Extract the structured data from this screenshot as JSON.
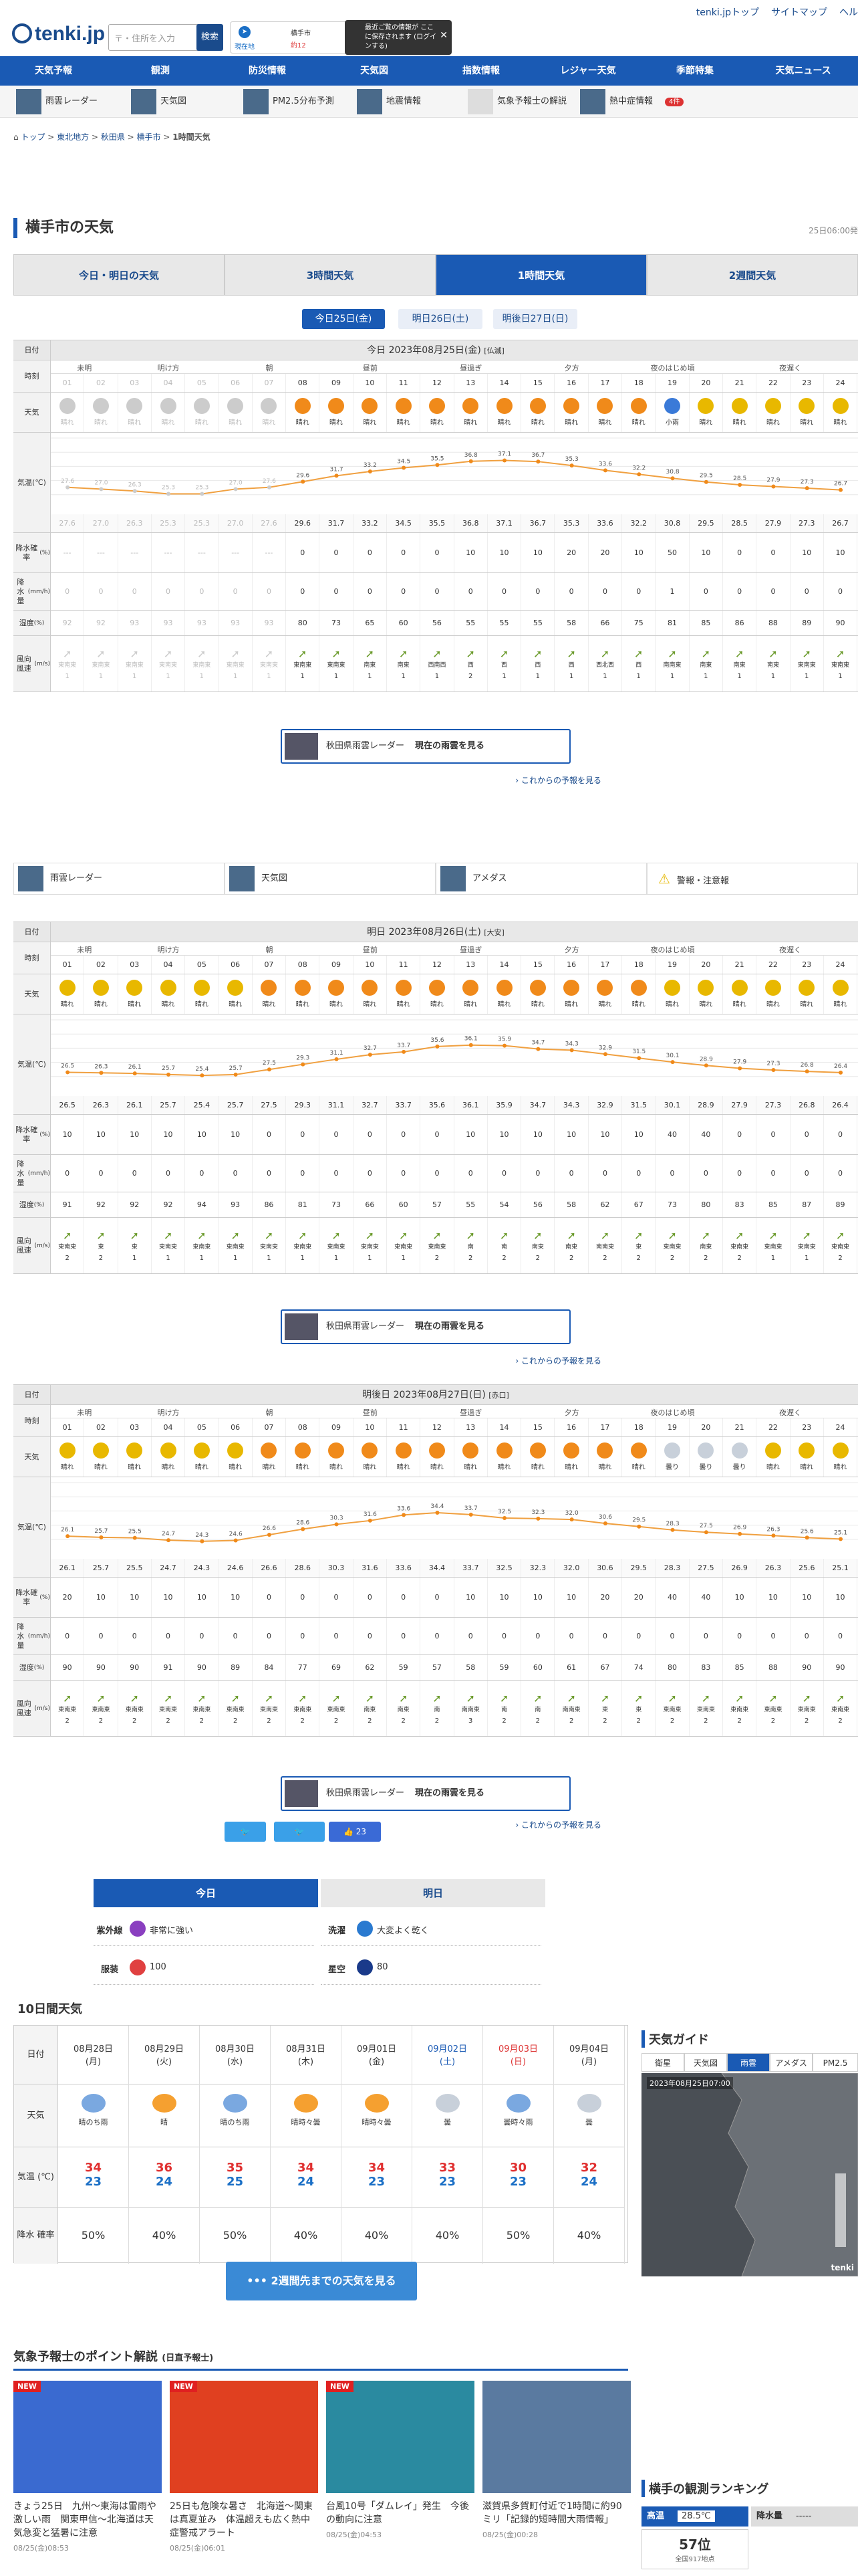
{
  "header": {
    "logo": "tenki.jp",
    "search_placeholder": "〒・住所を入力",
    "search_btn": "検索",
    "curloc_title": "現在地",
    "curloc_city": "横手市",
    "curloc_now": "約12",
    "tip": "最近ご覧の情報が ここに保存されます (ログインする)",
    "links": [
      "tenki.jpトップ",
      "サイトマップ",
      "ヘル"
    ]
  },
  "nav": [
    "天気予報",
    "観測",
    "防災情報",
    "天気図",
    "指数情報",
    "レジャー天気",
    "季節特集",
    "天気ニュース"
  ],
  "subnav": [
    "雨雲レーダー",
    "天気図",
    "PM2.5分布予測",
    "地震情報",
    "気象予報士の解説",
    "熱中症情報"
  ],
  "badge": "4件",
  "breadcrumb": [
    "トップ",
    "東北地方",
    "秋田県",
    "横手市",
    "1時間天気"
  ],
  "page_title": "横手市の天気",
  "page_date": "25日06:00発",
  "tabs": [
    "今日・明日の天気",
    "3時間天気",
    "1時間天気",
    "2週間天気"
  ],
  "date_tabs": [
    "今日25日(金)",
    "明日26日(土)",
    "明後日27日(日)"
  ],
  "labels": {
    "date": "日付",
    "time": "時刻",
    "weather": "天気",
    "temp": "気温",
    "temp_u": "(℃)",
    "temp_top": "高温",
    "prec": "降水確率",
    "prec_u": "(%)",
    "rain": "降水量",
    "rain_u": "(mm/h)",
    "hum": "湿度",
    "hum_u": "(%)",
    "wind": "風向 風速",
    "wind_u": "(m/s)"
  },
  "periods": [
    "未明",
    "明け方",
    "朝",
    "昼前",
    "昼過ぎ",
    "夕方",
    "夜のはじめ頃",
    "夜遅く"
  ],
  "hours": [
    "01",
    "02",
    "03",
    "04",
    "05",
    "06",
    "07",
    "08",
    "09",
    "10",
    "11",
    "12",
    "13",
    "14",
    "15",
    "16",
    "17",
    "18",
    "19",
    "20",
    "21",
    "22",
    "23",
    "24"
  ],
  "days": [
    {
      "head": "今日 2023年08月25日(金)",
      "rok": "[仏滅]",
      "past": 7,
      "weather": [
        "晴れ",
        "晴れ",
        "晴れ",
        "晴れ",
        "晴れ",
        "晴れ",
        "晴れ",
        "晴れ",
        "晴れ",
        "晴れ",
        "晴れ",
        "晴れ",
        "晴れ",
        "晴れ",
        "晴れ",
        "晴れ",
        "晴れ",
        "晴れ",
        "小雨",
        "晴れ",
        "晴れ",
        "晴れ",
        "晴れ",
        "晴れ"
      ],
      "temp": [
        "27.6",
        "27.0",
        "26.3",
        "25.3",
        "25.3",
        "27.0",
        "27.6",
        "29.6",
        "31.7",
        "33.2",
        "34.5",
        "35.5",
        "36.8",
        "37.1",
        "36.7",
        "35.3",
        "33.6",
        "32.2",
        "30.8",
        "29.5",
        "28.5",
        "27.9",
        "27.3",
        "26.7"
      ],
      "prec": [
        "---",
        "---",
        "---",
        "---",
        "---",
        "---",
        "---",
        "0",
        "0",
        "0",
        "0",
        "0",
        "10",
        "10",
        "10",
        "20",
        "20",
        "10",
        "50",
        "10",
        "0",
        "0",
        "10",
        "10"
      ],
      "rain": [
        "0",
        "0",
        "0",
        "0",
        "0",
        "0",
        "0",
        "0",
        "0",
        "0",
        "0",
        "0",
        "0",
        "0",
        "0",
        "0",
        "0",
        "0",
        "1",
        "0",
        "0",
        "0",
        "0",
        "0"
      ],
      "hum": [
        "92",
        "92",
        "93",
        "93",
        "93",
        "93",
        "93",
        "80",
        "73",
        "65",
        "60",
        "56",
        "55",
        "55",
        "55",
        "58",
        "66",
        "75",
        "81",
        "85",
        "86",
        "88",
        "89",
        "90"
      ],
      "wdir": [
        "東南東",
        "東南東",
        "東南東",
        "東南東",
        "東南東",
        "東南東",
        "東南東",
        "東南東",
        "東南東",
        "南東",
        "南東",
        "西南西",
        "西",
        "西",
        "西",
        "西",
        "西北西",
        "西",
        "南南東",
        "南東",
        "南東",
        "南東",
        "東南東",
        "東南東"
      ],
      "wsp": [
        "1",
        "1",
        "1",
        "1",
        "1",
        "1",
        "1",
        "1",
        "1",
        "1",
        "1",
        "1",
        "2",
        "1",
        "1",
        "1",
        "1",
        "1",
        "1",
        "1",
        "1",
        "1",
        "1",
        "1"
      ]
    },
    {
      "head": "明日 2023年08月26日(土)",
      "rok": "[大安]",
      "past": 0,
      "weather": [
        "晴れ",
        "晴れ",
        "晴れ",
        "晴れ",
        "晴れ",
        "晴れ",
        "晴れ",
        "晴れ",
        "晴れ",
        "晴れ",
        "晴れ",
        "晴れ",
        "晴れ",
        "晴れ",
        "晴れ",
        "晴れ",
        "晴れ",
        "晴れ",
        "晴れ",
        "晴れ",
        "晴れ",
        "晴れ",
        "晴れ",
        "晴れ"
      ],
      "temp": [
        "26.5",
        "26.3",
        "26.1",
        "25.7",
        "25.4",
        "25.7",
        "27.5",
        "29.3",
        "31.1",
        "32.7",
        "33.7",
        "35.6",
        "36.1",
        "35.9",
        "34.7",
        "34.3",
        "32.9",
        "31.5",
        "30.1",
        "28.9",
        "27.9",
        "27.3",
        "26.8",
        "26.4"
      ],
      "prec": [
        "10",
        "10",
        "10",
        "10",
        "10",
        "10",
        "0",
        "0",
        "0",
        "0",
        "0",
        "0",
        "10",
        "10",
        "10",
        "10",
        "10",
        "10",
        "40",
        "40",
        "0",
        "0",
        "0",
        "0"
      ],
      "rain": [
        "0",
        "0",
        "0",
        "0",
        "0",
        "0",
        "0",
        "0",
        "0",
        "0",
        "0",
        "0",
        "0",
        "0",
        "0",
        "0",
        "0",
        "0",
        "0",
        "0",
        "0",
        "0",
        "0",
        "0"
      ],
      "hum": [
        "91",
        "92",
        "92",
        "92",
        "94",
        "93",
        "86",
        "81",
        "73",
        "66",
        "60",
        "57",
        "55",
        "54",
        "56",
        "58",
        "62",
        "67",
        "73",
        "80",
        "83",
        "85",
        "87",
        "89"
      ],
      "wdir": [
        "東南東",
        "東",
        "東",
        "東南東",
        "東南東",
        "東南東",
        "東南東",
        "東南東",
        "東南東",
        "東南東",
        "東南東",
        "東南東",
        "南",
        "南",
        "南東",
        "南東",
        "南南東",
        "東",
        "東南東",
        "南東",
        "東南東",
        "東南東",
        "東南東",
        "東南東"
      ],
      "wsp": [
        "2",
        "2",
        "1",
        "1",
        "1",
        "1",
        "1",
        "1",
        "1",
        "1",
        "1",
        "2",
        "2",
        "2",
        "2",
        "2",
        "2",
        "2",
        "2",
        "2",
        "2",
        "1",
        "1",
        "2"
      ]
    },
    {
      "head": "明後日 2023年08月27日(日)",
      "rok": "[赤口]",
      "past": 0,
      "weather": [
        "晴れ",
        "晴れ",
        "晴れ",
        "晴れ",
        "晴れ",
        "晴れ",
        "晴れ",
        "晴れ",
        "晴れ",
        "晴れ",
        "晴れ",
        "晴れ",
        "晴れ",
        "晴れ",
        "晴れ",
        "晴れ",
        "晴れ",
        "晴れ",
        "曇り",
        "曇り",
        "曇り",
        "晴れ",
        "晴れ",
        "晴れ"
      ],
      "temp": [
        "26.1",
        "25.7",
        "25.5",
        "24.7",
        "24.3",
        "24.6",
        "26.6",
        "28.6",
        "30.3",
        "31.6",
        "33.6",
        "34.4",
        "33.7",
        "32.5",
        "32.3",
        "32.0",
        "30.6",
        "29.5",
        "28.3",
        "27.5",
        "26.9",
        "26.3",
        "25.6",
        "25.1"
      ],
      "prec": [
        "20",
        "10",
        "10",
        "10",
        "10",
        "10",
        "0",
        "0",
        "0",
        "0",
        "0",
        "0",
        "10",
        "10",
        "10",
        "10",
        "20",
        "20",
        "40",
        "40",
        "10",
        "10",
        "10",
        "10"
      ],
      "rain": [
        "0",
        "0",
        "0",
        "0",
        "0",
        "0",
        "0",
        "0",
        "0",
        "0",
        "0",
        "0",
        "0",
        "0",
        "0",
        "0",
        "0",
        "0",
        "0",
        "0",
        "0",
        "0",
        "0",
        "0"
      ],
      "hum": [
        "90",
        "90",
        "90",
        "91",
        "90",
        "89",
        "84",
        "77",
        "69",
        "62",
        "59",
        "57",
        "58",
        "59",
        "60",
        "61",
        "67",
        "74",
        "80",
        "83",
        "85",
        "88",
        "90",
        "90"
      ],
      "wdir": [
        "東南東",
        "東南東",
        "東南東",
        "東南東",
        "東南東",
        "東南東",
        "東南東",
        "東南東",
        "東南東",
        "南東",
        "南東",
        "南",
        "南南東",
        "南",
        "南",
        "南南東",
        "東",
        "東",
        "東南東",
        "東南東",
        "東南東",
        "東南東",
        "東南東",
        "東南東"
      ],
      "wsp": [
        "2",
        "2",
        "2",
        "2",
        "2",
        "2",
        "2",
        "2",
        "2",
        "2",
        "2",
        "2",
        "3",
        "2",
        "2",
        "2",
        "2",
        "2",
        "2",
        "2",
        "2",
        "2",
        "2",
        "2"
      ]
    }
  ],
  "radar": {
    "area": "秋田県雨雲レーダー",
    "link": "現在の雨雲を見る",
    "more": "これからの予報を見る"
  },
  "bar2": [
    "雨雲レーダー",
    "天気図",
    "アメダス",
    "警報・注意報"
  ],
  "share": [
    "",
    "",
    "23"
  ],
  "life": {
    "tabs": [
      "今日",
      "明日"
    ],
    "items": [
      {
        "k": "紫外線",
        "v": "非常に強い",
        "c": "#8a3fc0"
      },
      {
        "k": "洗濯",
        "v": "大変よく乾く",
        "c": "#2a7ad0"
      },
      {
        "k": "服装",
        "v": "100",
        "c": "#e04040"
      },
      {
        "k": "星空",
        "v": "80",
        "c": "#1a3a8a"
      }
    ]
  },
  "ten": {
    "title": "10日間天気",
    "rows": [
      "日付",
      "天気",
      "気温 (℃)",
      "降水 確率"
    ],
    "days": [
      {
        "d": "08月28日",
        "w": "(月)",
        "wx": "晴のち雨",
        "hi": "34",
        "lo": "23",
        "p": "50%"
      },
      {
        "d": "08月29日",
        "w": "(火)",
        "wx": "晴",
        "hi": "36",
        "lo": "24",
        "p": "40%"
      },
      {
        "d": "08月30日",
        "w": "(水)",
        "wx": "晴のち雨",
        "hi": "35",
        "lo": "25",
        "p": "50%"
      },
      {
        "d": "08月31日",
        "w": "(木)",
        "wx": "晴時々曇",
        "hi": "34",
        "lo": "24",
        "p": "40%"
      },
      {
        "d": "09月01日",
        "w": "(金)",
        "wx": "晴時々曇",
        "hi": "34",
        "lo": "23",
        "p": "40%"
      },
      {
        "d": "09月02日",
        "w": "(土)",
        "wx": "曇",
        "hi": "33",
        "lo": "23",
        "p": "40%"
      },
      {
        "d": "09月03日",
        "w": "(日)",
        "wx": "曇時々雨",
        "hi": "30",
        "lo": "23",
        "p": "50%"
      },
      {
        "d": "09月04日",
        "w": "(月)",
        "wx": "曇",
        "hi": "32",
        "lo": "24",
        "p": "40%"
      }
    ],
    "btn": "2週間先までの天気を見る"
  },
  "guide": {
    "title": "天気ガイド",
    "tabs": [
      "衛星",
      "天気図",
      "雨雲",
      "アメダス",
      "PM2.5"
    ],
    "time": "2023年08月25日07:00",
    "logo": "tenki"
  },
  "points": {
    "title": "気象予報士のポイント解説",
    "sub": "(日直予報士)",
    "items": [
      {
        "t": "きょう25日　九州〜東海は雷雨や激しい雨　関東甲信〜北海道は天気急変と猛暑に注意",
        "d": "08/25(金)08:53",
        "new": "NEW"
      },
      {
        "t": "25日も危険な暑さ　北海道〜関東は真夏並み　体温超えも広く熱中症警戒アラート",
        "d": "08/25(金)06:01",
        "new": "NEW"
      },
      {
        "t": "台風10号「ダムレイ」発生　今後の動向に注意",
        "d": "08/25(金)04:53",
        "new": "NEW"
      },
      {
        "t": "滋賀県多賀町付近で1時間に約90ミリ「記録的短時間大雨情報」",
        "d": "08/25(金)00:28",
        "new": ""
      }
    ]
  },
  "rank": {
    "title": "横手の観測ランキング",
    "h1": "高温",
    "v1": "28.5℃",
    "h2": "降水量",
    "v2": "-----",
    "pos": "57位",
    "pos_sub": "全国917地点"
  }
}
